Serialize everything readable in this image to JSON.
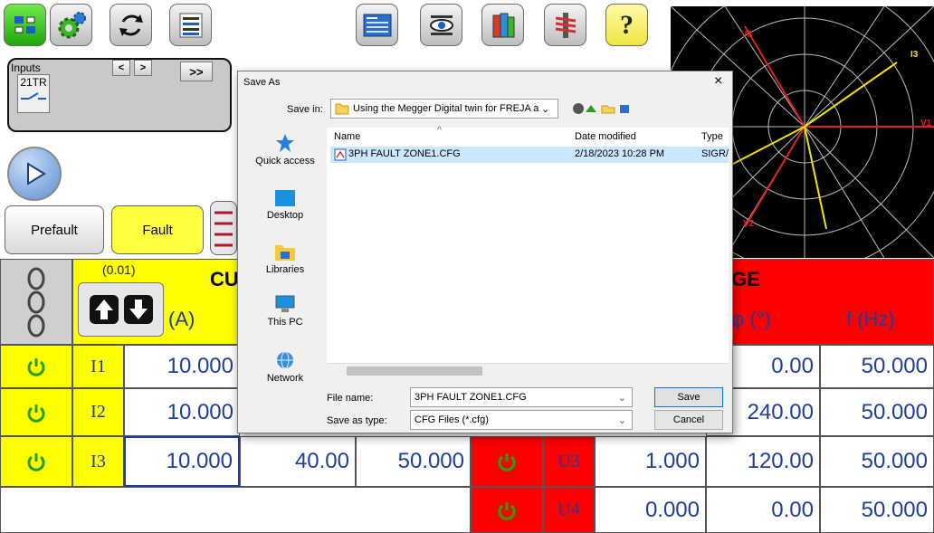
{
  "toolbar": {
    "buttons": [
      "station-icon",
      "gear-icon",
      "refresh-icon",
      "list-settings-icon",
      "report-icon",
      "eye-display-icon",
      "books-icon",
      "tools-icon",
      "help-icon"
    ],
    "help_label": "?"
  },
  "inputs": {
    "title": "Inputs",
    "tr_label": "21TR",
    "prev_label": "<",
    "next_label": ">",
    "forward_label": ">>"
  },
  "modes": {
    "prefault": "Prefault",
    "fault": "Fault"
  },
  "current_table": {
    "step_value": "(0.01)",
    "header_partial": "CU",
    "unit": "(A)",
    "rows": [
      {
        "label": "I1",
        "amplitude": "10.000"
      },
      {
        "label": "I2",
        "amplitude": "10.000"
      },
      {
        "label": "I3",
        "amplitude": "10.000",
        "phase": "40.00",
        "freq": "50.000"
      }
    ]
  },
  "voltage_table": {
    "header_partial": "GE",
    "phase_unit": "φ  (°)",
    "freq_unit": "f  (Hz)",
    "rows": [
      {
        "phase": "0.00",
        "freq": "50.000"
      },
      {
        "phase": "240.00",
        "freq": "50.000"
      },
      {
        "label": "U3",
        "amplitude": "1.000",
        "phase": "120.00",
        "freq": "50.000"
      },
      {
        "label": "U4",
        "amplitude": "0.000",
        "phase": "0.00",
        "freq": "50.000"
      }
    ]
  },
  "polar": {
    "labels": [
      "V3",
      "I3",
      "V1",
      "V2"
    ]
  },
  "dialog": {
    "title": "Save As",
    "close_label": "×",
    "save_in_label": "Save in:",
    "save_in_value": "Using the Megger Digital twin for FREJA and :",
    "columns": {
      "name": "Name",
      "date": "Date modified",
      "type": "Type"
    },
    "files": [
      {
        "name": "3PH FAULT ZONE1.CFG",
        "date": "2/18/2023 10:28 PM",
        "type": "SIGR/"
      }
    ],
    "places": [
      "Quick access",
      "Desktop",
      "Libraries",
      "This PC",
      "Network"
    ],
    "file_name_label": "File name:",
    "file_name_value": "3PH FAULT ZONE1.CFG",
    "save_type_label": "Save as type:",
    "save_type_value": "CFG Files (*.cfg)",
    "save_button": "Save",
    "cancel_button": "Cancel"
  },
  "colors": {
    "value_blue": "#1e3d9c",
    "yellow": "#ffff00",
    "red": "#ff0000",
    "power_green": "#2a9d1b"
  }
}
